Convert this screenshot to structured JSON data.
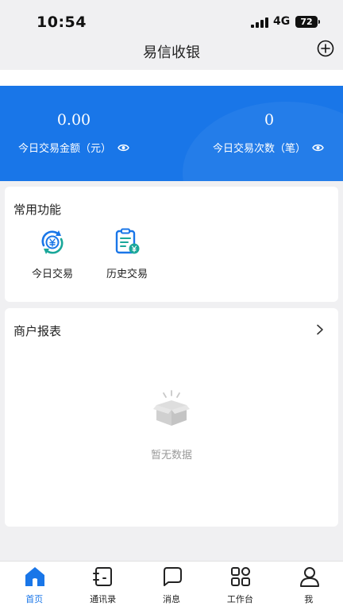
{
  "status_bar": {
    "time": "10:54",
    "network": "4G",
    "battery": "72"
  },
  "header": {
    "title": "易信收银",
    "add_icon": "plus-circle-icon"
  },
  "stats": {
    "amount_value": "0.00",
    "amount_label": "今日交易金额（元）",
    "count_value": "0",
    "count_label": "今日交易次数（笔）",
    "toggle_icon": "eye-icon"
  },
  "functions": {
    "title": "常用功能",
    "items": [
      {
        "label": "今日交易",
        "icon": "yuan-cycle-icon"
      },
      {
        "label": "历史交易",
        "icon": "history-document-icon"
      }
    ]
  },
  "report": {
    "title": "商户报表",
    "empty_text": "暂无数据",
    "empty_icon": "empty-box-icon"
  },
  "tab_bar": {
    "items": [
      {
        "label": "首页",
        "icon": "home-icon",
        "active": true
      },
      {
        "label": "通讯录",
        "icon": "contacts-icon",
        "active": false
      },
      {
        "label": "消息",
        "icon": "message-icon",
        "active": false
      },
      {
        "label": "工作台",
        "icon": "grid-icon",
        "active": false
      },
      {
        "label": "我",
        "icon": "person-icon",
        "active": false
      }
    ]
  },
  "colors": {
    "primary": "#1976e8",
    "accent_teal": "#1aa79a",
    "background": "#f0f0f2"
  }
}
